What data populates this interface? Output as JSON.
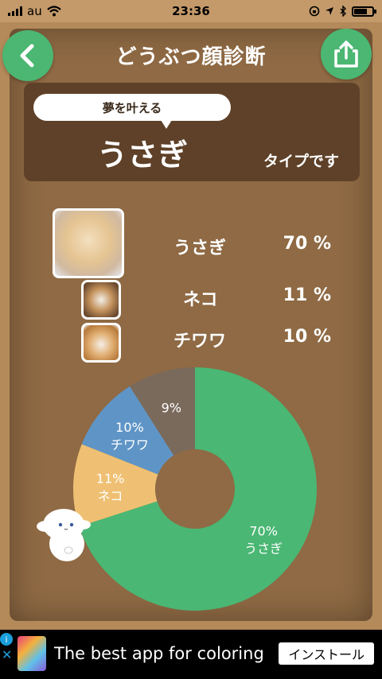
{
  "status_bar": {
    "carrier": "au",
    "time": "23:36"
  },
  "header": {
    "title": "どうぶつ顔診断",
    "back_icon": "chevron-left-icon",
    "share_icon": "share-icon"
  },
  "result": {
    "bubble_text": "夢を叶える",
    "animal": "うさぎ",
    "suffix": "タイプです"
  },
  "ranking": [
    {
      "name": "うさぎ",
      "percent": "70 %"
    },
    {
      "name": "ネコ",
      "percent": "11 %"
    },
    {
      "name": "チワワ",
      "percent": "10 %"
    }
  ],
  "chart_data": {
    "type": "pie",
    "donut": true,
    "categories": [
      "うさぎ",
      "ネコ",
      "チワワ",
      ""
    ],
    "values": [
      70,
      11,
      10,
      9
    ],
    "colors": [
      "#4ab774",
      "#efc073",
      "#5f95c6",
      "#7a6a5c"
    ],
    "labels": [
      "70%",
      "11%",
      "10%",
      "9%"
    ]
  },
  "ad": {
    "text": "The best app for coloring",
    "button": "インストール"
  }
}
